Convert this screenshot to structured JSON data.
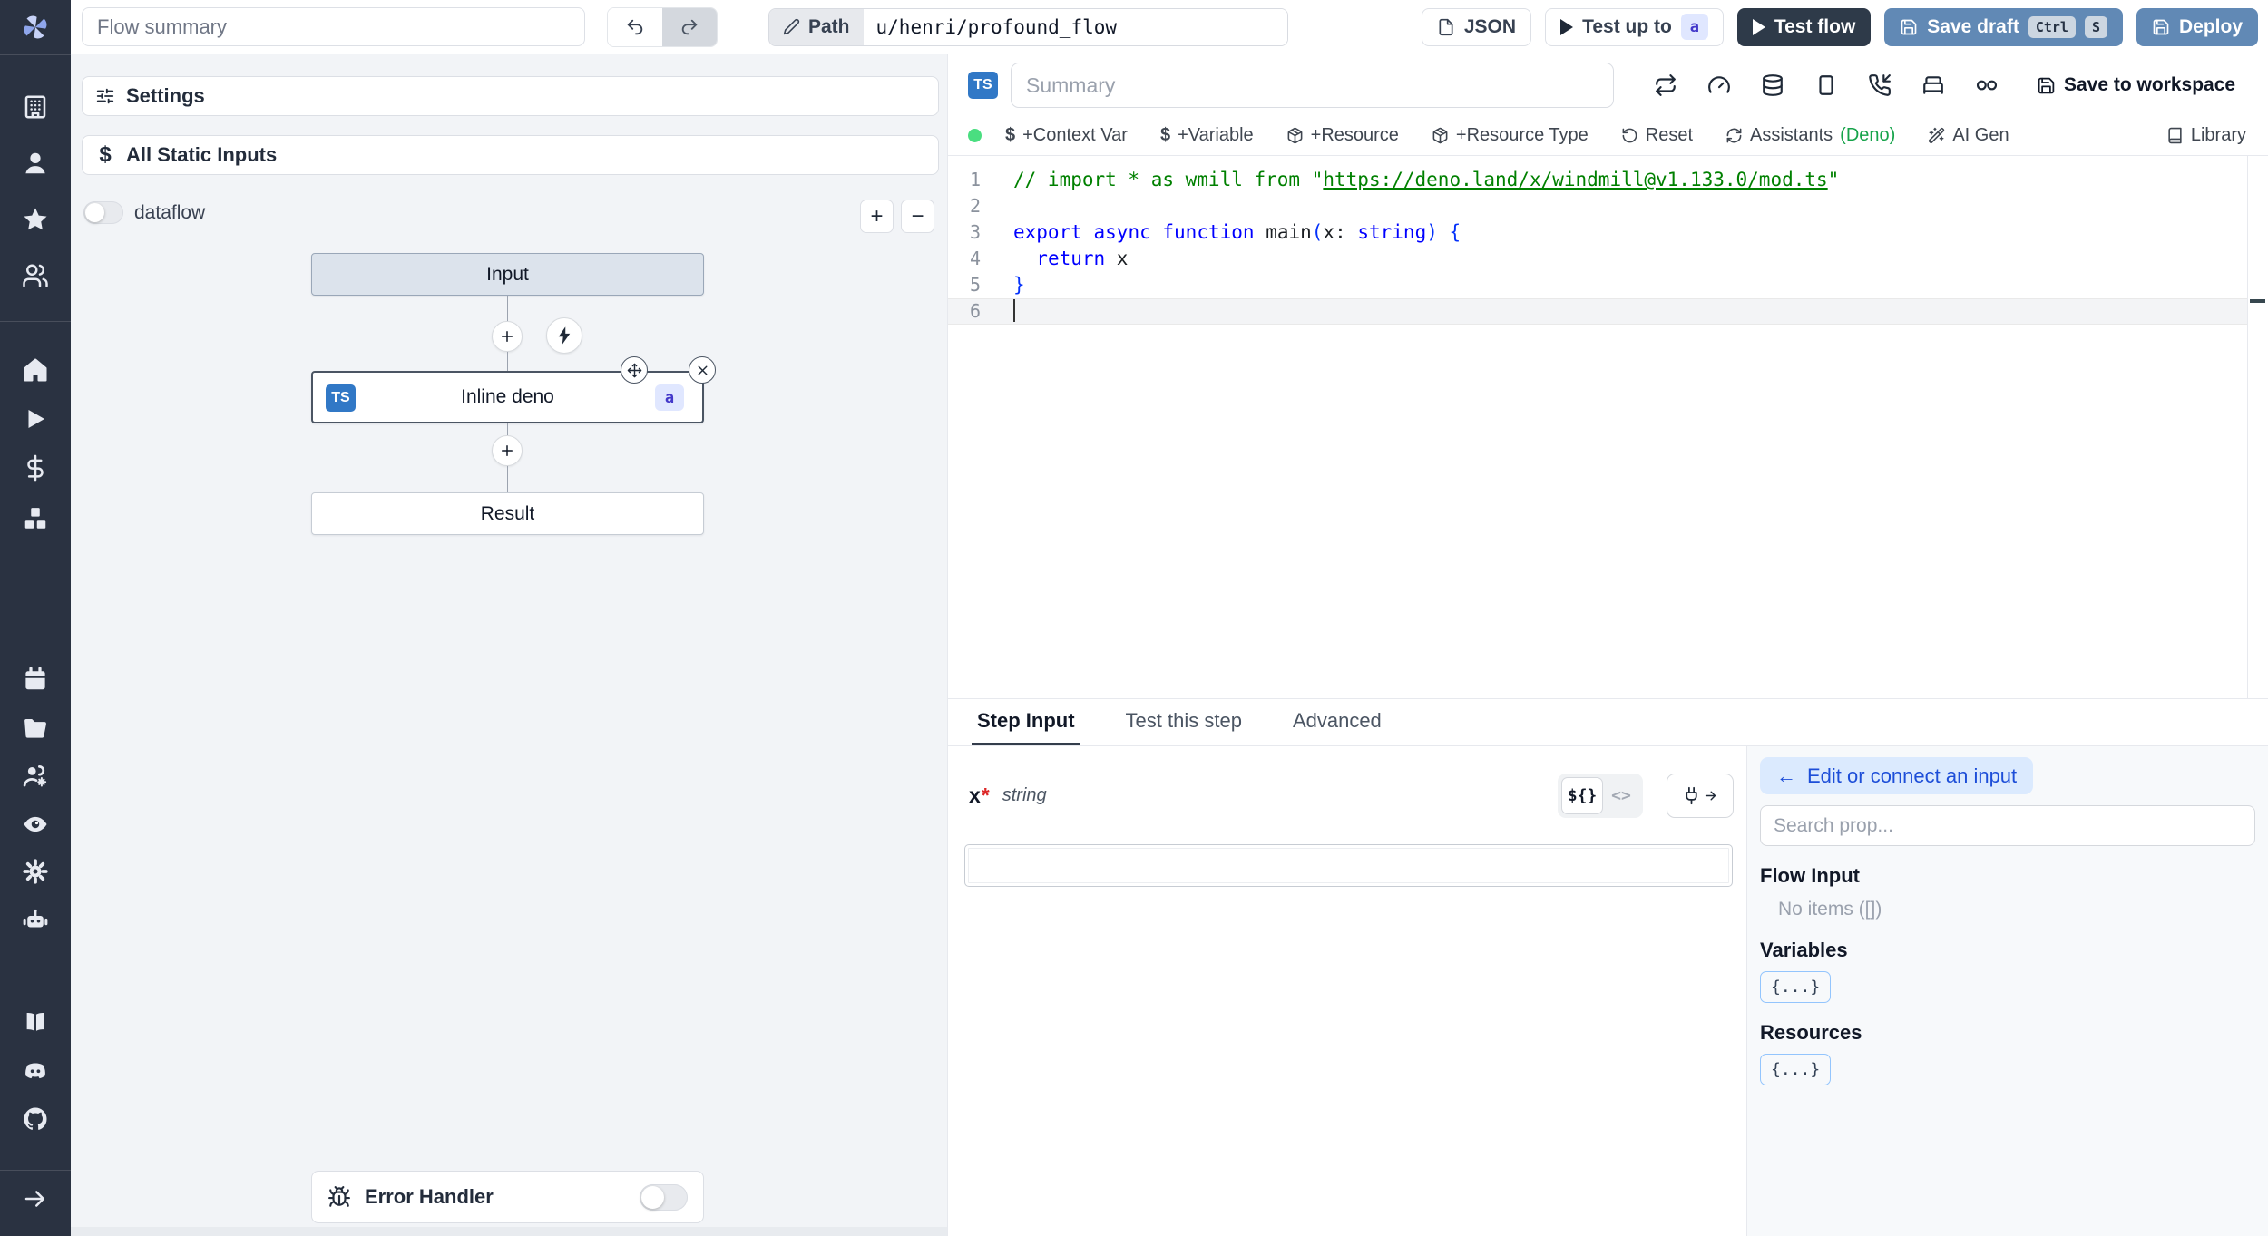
{
  "topbar": {
    "summary_placeholder": "Flow summary",
    "path": {
      "label": "Path",
      "value": "u/henri/profound_flow"
    },
    "buttons": {
      "json": "JSON",
      "test_up_to": "Test up to",
      "test_up_to_badge": "a",
      "test_flow": "Test flow",
      "save_draft": "Save draft",
      "kbd": [
        "Ctrl",
        "S"
      ],
      "deploy": "Deploy"
    }
  },
  "sidebar": {
    "icons": [
      "windmill-logo",
      "building",
      "user",
      "star",
      "users",
      "home",
      "play",
      "dollar",
      "boxes",
      "calendar",
      "folder",
      "users-gear",
      "eye",
      "gear",
      "robot",
      "book",
      "discord",
      "github",
      "arrow-right"
    ]
  },
  "flow_panel": {
    "settings": "Settings",
    "all_static_inputs": "All Static Inputs",
    "dataflow": "dataflow",
    "zoom_in": "+",
    "zoom_out": "−",
    "graph": {
      "input_node": "Input",
      "step_node": {
        "lang_badge": "TS",
        "label": "Inline deno",
        "id_badge": "a"
      },
      "result_node": "Result"
    },
    "error_handler": "Error Handler"
  },
  "editor": {
    "lang_badge": "TS",
    "summary_placeholder": "Summary",
    "step_setting_icons": [
      "repeat",
      "gauge",
      "database",
      "square",
      "phone-incoming",
      "bed",
      "voicemail"
    ],
    "save_to_workspace": "Save to workspace",
    "toolbar": {
      "context_var": "+Context Var",
      "variable": "+Variable",
      "resource": "+Resource",
      "resource_type": "+Resource Type",
      "reset": "Reset",
      "assistants": "Assistants",
      "assistants_lang": "(Deno)",
      "ai_gen": "AI Gen",
      "library": "Library"
    },
    "code": {
      "lines": [
        {
          "n": "1",
          "current": false,
          "tokens": [
            {
              "t": "// import * as wmill from \"",
              "c": "cm"
            },
            {
              "t": "https://deno.land/x/windmill@v1.133.0/mod.ts",
              "c": "lk"
            },
            {
              "t": "\"",
              "c": "cm"
            }
          ]
        },
        {
          "n": "2",
          "current": false,
          "tokens": []
        },
        {
          "n": "3",
          "current": false,
          "tokens": [
            {
              "t": "export",
              "c": "kw"
            },
            {
              "t": " ",
              "c": "pl"
            },
            {
              "t": "async",
              "c": "kw"
            },
            {
              "t": " ",
              "c": "pl"
            },
            {
              "t": "function",
              "c": "kw"
            },
            {
              "t": " main",
              "c": "pl"
            },
            {
              "t": "(",
              "c": "br"
            },
            {
              "t": "x: ",
              "c": "pl"
            },
            {
              "t": "string",
              "c": "kw"
            },
            {
              "t": ")",
              "c": "br"
            },
            {
              "t": " ",
              "c": "pl"
            },
            {
              "t": "{",
              "c": "br"
            }
          ]
        },
        {
          "n": "4",
          "current": false,
          "tokens": [
            {
              "t": "  ",
              "c": "pl"
            },
            {
              "t": "return",
              "c": "kw"
            },
            {
              "t": " x",
              "c": "pl"
            }
          ]
        },
        {
          "n": "5",
          "current": false,
          "tokens": [
            {
              "t": "}",
              "c": "br"
            }
          ]
        },
        {
          "n": "6",
          "current": true,
          "tokens": []
        }
      ]
    }
  },
  "step_panel": {
    "tabs": [
      {
        "label": "Step Input",
        "active": true
      },
      {
        "label": "Test this step",
        "active": false
      },
      {
        "label": "Advanced",
        "active": false
      }
    ],
    "field": {
      "name": "x",
      "required_mark": "*",
      "type": "string",
      "value": "",
      "expr_toggle": "${}",
      "code_toggle": "<>"
    }
  },
  "connect_panel": {
    "edit_button": "Edit or connect an input",
    "back_arrow": "←",
    "search_placeholder": "Search prop...",
    "flow_input_title": "Flow Input",
    "flow_input_empty": "No items ([])",
    "variables_title": "Variables",
    "variables_chip": "{...}",
    "resources_title": "Resources",
    "resources_chip": "{...}"
  },
  "colors": {
    "sidebar_bg": "#2a3241",
    "canvas_bg": "#f2f4f7",
    "primary_button": "#6189b5",
    "dark_button": "#2e3a49",
    "ts_badge": "#3178c6",
    "indigo_chip_bg": "#e0e7ff",
    "indigo_chip_text": "#4338ca",
    "edit_btn_bg": "#dbeafe",
    "edit_btn_text": "#1d4ed8",
    "green_dot": "#4ade80",
    "deno_green": "#16a34a",
    "code_keyword": "#0000ff",
    "code_comment": "#008000"
  }
}
